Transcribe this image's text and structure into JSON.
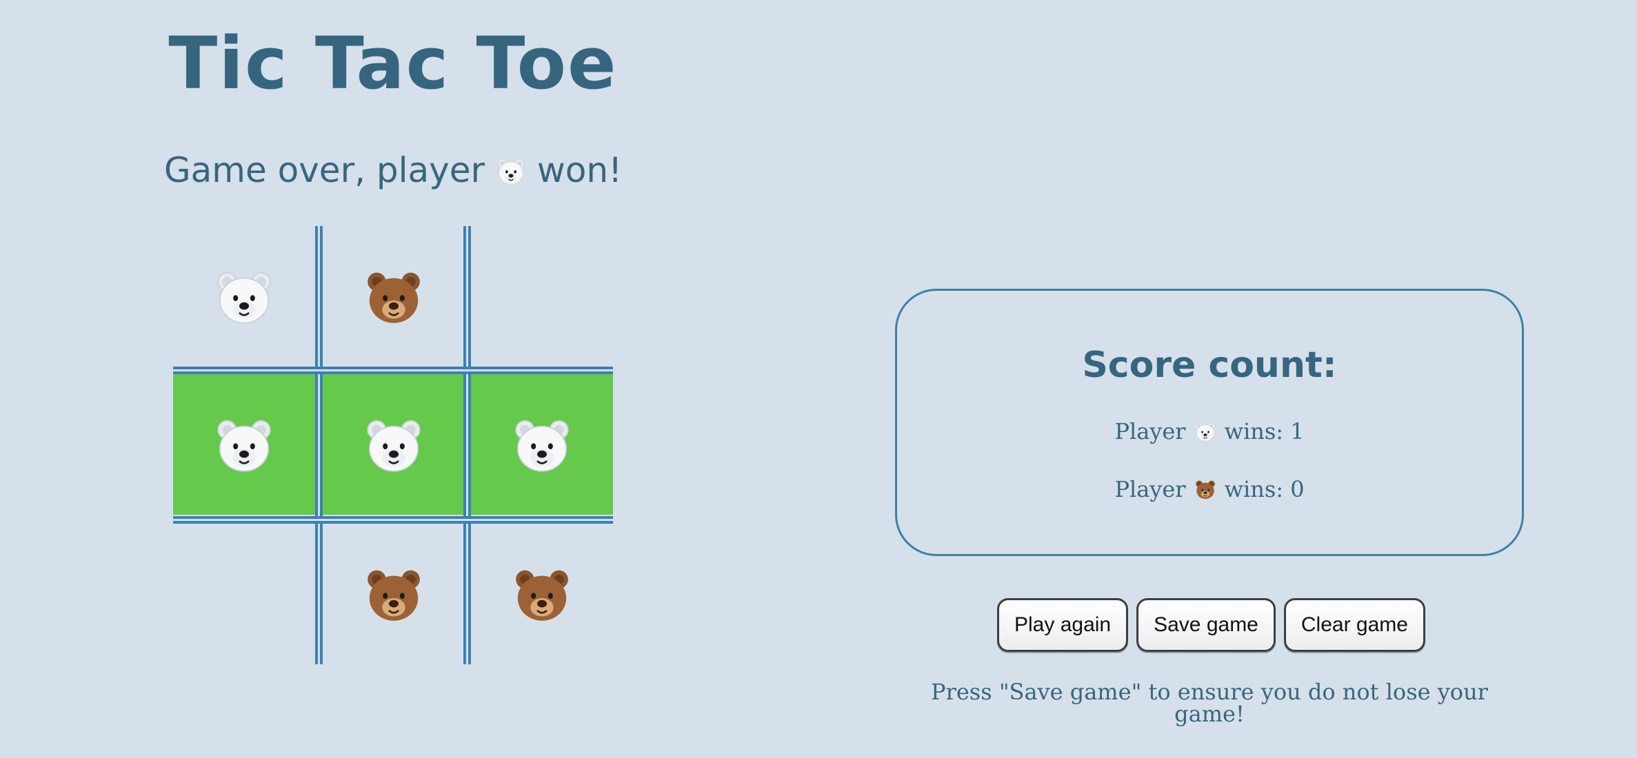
{
  "header": {
    "title": "Tic Tac Toe"
  },
  "status": {
    "prefix": "Game over, player",
    "suffix": "won!",
    "winner_icon": "polar-bear-icon"
  },
  "board": {
    "cells": [
      {
        "mark": "polar-bear",
        "winning": false
      },
      {
        "mark": "brown-bear",
        "winning": false
      },
      {
        "mark": "",
        "winning": false
      },
      {
        "mark": "polar-bear",
        "winning": true
      },
      {
        "mark": "polar-bear",
        "winning": true
      },
      {
        "mark": "polar-bear",
        "winning": true
      },
      {
        "mark": "",
        "winning": false
      },
      {
        "mark": "brown-bear",
        "winning": false
      },
      {
        "mark": "brown-bear",
        "winning": false
      }
    ],
    "win_color": "#65c94c",
    "line_color": "#3b82b1"
  },
  "score": {
    "title": "Score count:",
    "player1": {
      "prefix": "Player",
      "icon": "polar-bear-icon",
      "label": "wins: 1"
    },
    "player2": {
      "prefix": "Player",
      "icon": "brown-bear-icon",
      "label": "wins: 0"
    }
  },
  "actions": {
    "play_again": "Play again",
    "save_game": "Save game",
    "clear_game": "Clear game"
  },
  "hint": "Press \"Save game\" to ensure you do not lose your game!",
  "colors": {
    "background": "#d6e0ea",
    "text": "#36667f",
    "border": "#3d80a8"
  }
}
